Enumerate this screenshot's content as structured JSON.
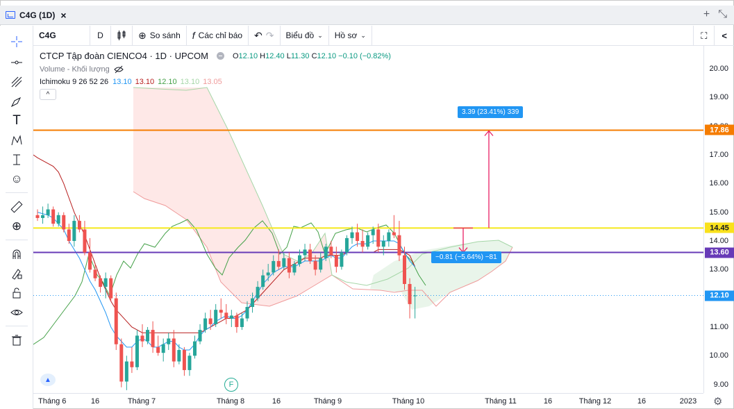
{
  "window": {
    "tab_title": "C4G (1D)",
    "close_glyph": "×",
    "add_glyph": "+",
    "shrink_glyph": "⤡"
  },
  "toolbar": {
    "symbol": "C4G",
    "interval": "D",
    "compare_label": "So sánh",
    "indicators_label": "Các chỉ báo",
    "chart_type_label": "Biểu đồ",
    "profile_label": "Hồ sơ",
    "undo_glyph": "↶",
    "redo_glyph": "↷",
    "fullscreen_glyph": "⛶",
    "share_glyph": "<"
  },
  "legend": {
    "name": "CTCP Tập đoàn CIENCO4 · 1D · UPCOM",
    "open_label": "O",
    "open": "12.10",
    "high_label": "H",
    "high": "12.40",
    "low_label": "L",
    "low": "11.30",
    "close_label": "C",
    "close": "12.10",
    "change": "−0.10 (−0.82%)",
    "volume_label": "Volume - Khối lượng",
    "ichimoku_label": "Ichimoku 9 26 52 26",
    "ichimoku_values": [
      {
        "value": "13.10",
        "color": "#2196f3"
      },
      {
        "value": "13.10",
        "color": "#b71c1c"
      },
      {
        "value": "12.10",
        "color": "#43a047"
      },
      {
        "value": "13.10",
        "color": "#a5d6a7"
      },
      {
        "value": "13.05",
        "color": "#ef9a9a"
      }
    ],
    "collapse_glyph": "^"
  },
  "measure_up": {
    "text": "3.39 (23.41%) 339",
    "color": "#2196f3"
  },
  "measure_down": {
    "text": "−0.81 (−5.64%) −81",
    "color": "#2196f3"
  },
  "marker_f": "F",
  "yaxis": {
    "ticks": [
      "20.00",
      "19.00",
      "18.00",
      "17.00",
      "16.00",
      "15.00",
      "14.00",
      "13.00",
      "12.00",
      "11.00",
      "10.00",
      "9.00"
    ],
    "ticks_val": [
      20,
      19,
      18,
      17,
      16,
      15,
      14,
      13,
      12,
      11,
      10,
      9
    ],
    "badges": [
      {
        "text": "17.86",
        "value": 17.86,
        "color": "#f57c00"
      },
      {
        "text": "14.45",
        "value": 14.45,
        "color": "#f9e11c",
        "text_color": "#131722"
      },
      {
        "text": "13.60",
        "value": 13.6,
        "color": "#673ab7"
      },
      {
        "text": "12.10",
        "value": 12.1,
        "color": "#2196f3"
      }
    ]
  },
  "xaxis": {
    "ticks": [
      "Tháng 6",
      "16",
      "Tháng 7",
      "Tháng 8",
      "16",
      "Tháng 9",
      "Tháng 10",
      "Tháng 11",
      "16",
      "Tháng 12",
      "16",
      "2023"
    ]
  },
  "levels": {
    "orange": 17.86,
    "yellow": 14.45,
    "purple": 13.6,
    "last": 12.1,
    "colors": {
      "orange": "#f57c00",
      "yellow": "#f5e91b",
      "purple": "#673ab7"
    }
  },
  "chart_data": {
    "type": "candlestick",
    "yrange": [
      8.7,
      20.8
    ],
    "candles": [
      [
        14.9,
        15.1,
        14.7,
        14.8
      ],
      [
        14.8,
        15.2,
        14.6,
        14.9
      ],
      [
        14.9,
        15.3,
        14.8,
        15.1
      ],
      [
        15.1,
        15.2,
        14.5,
        14.6
      ],
      [
        14.6,
        15.0,
        14.5,
        14.9
      ],
      [
        14.9,
        15.0,
        14.3,
        14.4
      ],
      [
        14.4,
        14.6,
        13.9,
        14.0
      ],
      [
        14.0,
        14.9,
        13.8,
        14.7
      ],
      [
        14.7,
        14.9,
        14.3,
        14.4
      ],
      [
        14.4,
        14.7,
        13.5,
        13.6
      ],
      [
        13.6,
        14.1,
        12.9,
        13.0
      ],
      [
        13.0,
        13.2,
        12.6,
        12.7
      ],
      [
        12.7,
        12.8,
        12.2,
        12.4
      ],
      [
        12.4,
        12.9,
        12.0,
        12.7
      ],
      [
        12.7,
        12.8,
        11.9,
        12.0
      ],
      [
        12.0,
        12.2,
        10.2,
        10.4
      ],
      [
        10.4,
        10.6,
        8.9,
        9.1
      ],
      [
        9.1,
        10.0,
        8.8,
        9.8
      ],
      [
        9.8,
        10.3,
        9.4,
        9.6
      ],
      [
        9.6,
        10.9,
        9.5,
        10.7
      ],
      [
        10.7,
        11.1,
        10.3,
        10.5
      ],
      [
        10.5,
        11.0,
        10.4,
        10.9
      ],
      [
        10.9,
        11.2,
        10.1,
        10.3
      ],
      [
        10.3,
        10.7,
        10.0,
        10.1
      ],
      [
        10.1,
        10.6,
        9.8,
        10.4
      ],
      [
        10.4,
        10.8,
        10.2,
        10.6
      ],
      [
        10.6,
        10.9,
        9.6,
        9.8
      ],
      [
        9.8,
        10.4,
        9.7,
        10.2
      ],
      [
        10.2,
        10.3,
        9.3,
        9.5
      ],
      [
        9.5,
        10.1,
        9.3,
        10.0
      ],
      [
        10.0,
        10.7,
        9.9,
        10.5
      ],
      [
        10.5,
        11.1,
        10.4,
        10.9
      ],
      [
        10.9,
        11.5,
        10.8,
        11.3
      ],
      [
        11.3,
        11.6,
        10.9,
        11.1
      ],
      [
        11.1,
        11.8,
        11.0,
        11.6
      ],
      [
        11.6,
        12.0,
        11.3,
        11.5
      ],
      [
        11.5,
        11.8,
        11.1,
        11.3
      ],
      [
        11.3,
        11.6,
        11.0,
        11.4
      ],
      [
        11.4,
        11.5,
        10.8,
        11.0
      ],
      [
        11.0,
        11.5,
        10.9,
        11.3
      ],
      [
        11.3,
        11.9,
        11.2,
        11.7
      ],
      [
        11.7,
        12.2,
        11.5,
        12.0
      ],
      [
        12.0,
        12.6,
        11.9,
        12.4
      ],
      [
        12.4,
        13.0,
        12.3,
        12.8
      ],
      [
        12.8,
        13.2,
        12.6,
        12.9
      ],
      [
        12.9,
        13.5,
        12.8,
        13.3
      ],
      [
        13.3,
        13.7,
        13.0,
        13.1
      ],
      [
        13.1,
        13.6,
        13.0,
        13.4
      ],
      [
        13.4,
        13.6,
        12.7,
        12.9
      ],
      [
        12.9,
        13.3,
        12.8,
        13.2
      ],
      [
        13.2,
        13.7,
        13.1,
        13.5
      ],
      [
        13.5,
        13.9,
        13.3,
        13.7
      ],
      [
        13.7,
        13.9,
        13.2,
        13.3
      ],
      [
        13.3,
        13.5,
        12.8,
        13.0
      ],
      [
        13.0,
        13.6,
        12.9,
        13.4
      ],
      [
        13.4,
        13.9,
        13.3,
        13.8
      ],
      [
        13.8,
        14.0,
        13.4,
        13.5
      ],
      [
        13.5,
        13.8,
        12.9,
        13.1
      ],
      [
        13.1,
        13.7,
        13.0,
        13.6
      ],
      [
        13.6,
        14.2,
        13.5,
        14.1
      ],
      [
        14.1,
        14.5,
        13.9,
        14.3
      ],
      [
        14.3,
        14.6,
        13.8,
        14.0
      ],
      [
        14.0,
        14.4,
        13.6,
        13.8
      ],
      [
        13.8,
        14.3,
        13.7,
        14.2
      ],
      [
        14.2,
        14.5,
        13.9,
        14.4
      ],
      [
        14.4,
        14.6,
        13.6,
        13.8
      ],
      [
        13.8,
        14.2,
        13.5,
        14.0
      ],
      [
        14.0,
        14.4,
        13.8,
        14.3
      ],
      [
        14.3,
        14.9,
        14.1,
        14.2
      ],
      [
        14.2,
        14.7,
        13.3,
        13.5
      ],
      [
        13.5,
        13.8,
        12.3,
        12.5
      ],
      [
        12.5,
        12.7,
        11.3,
        11.8
      ],
      [
        12.1,
        12.4,
        11.3,
        12.1
      ]
    ],
    "tenkan": [
      15.0,
      14.95,
      14.9,
      14.8,
      14.6,
      14.4,
      14.0,
      13.7,
      13.4,
      13.0,
      12.6,
      12.3,
      11.9,
      11.5,
      11.0,
      10.7,
      10.5,
      10.3,
      10.3,
      10.5,
      10.6,
      10.5,
      10.3,
      10.3,
      10.4,
      10.5,
      10.5,
      10.3,
      10.2,
      10.2,
      10.4,
      10.7,
      10.9,
      11.0,
      11.2,
      11.3,
      11.4,
      11.3,
      11.3,
      11.4,
      11.6,
      11.9,
      12.2,
      12.5,
      12.7,
      12.9,
      13.0,
      13.1,
      13.1,
      13.1,
      13.2,
      13.3,
      13.3,
      13.3,
      13.3,
      13.4,
      13.5,
      13.4,
      13.4,
      13.6,
      13.8,
      13.9,
      13.9,
      13.9,
      14.0,
      14.0,
      14.0,
      14.0,
      14.0,
      13.9,
      13.6,
      13.3,
      13.1
    ],
    "kijun": [
      16.9,
      16.8,
      16.7,
      16.6,
      16.4,
      16.0,
      15.5,
      15.0,
      14.6,
      14.2,
      13.7,
      13.2,
      12.7,
      12.3,
      11.9,
      11.6,
      11.4,
      11.2,
      11.0,
      10.9,
      10.8,
      10.8,
      10.8,
      10.8,
      10.8,
      10.8,
      10.8,
      10.8,
      10.8,
      10.8,
      10.8,
      10.8,
      10.9,
      11.0,
      11.1,
      11.2,
      11.3,
      11.3,
      11.4,
      11.5,
      11.6,
      11.8,
      12.0,
      12.2,
      12.4,
      12.6,
      12.8,
      13.0,
      13.1,
      13.2,
      13.3,
      13.4,
      13.4,
      13.4,
      13.4,
      13.5,
      13.5,
      13.5,
      13.5,
      13.6,
      13.6,
      13.6,
      13.6,
      13.6,
      13.6,
      13.7,
      13.7,
      13.7,
      13.7,
      13.7,
      13.6,
      13.5,
      13.1
    ]
  }
}
